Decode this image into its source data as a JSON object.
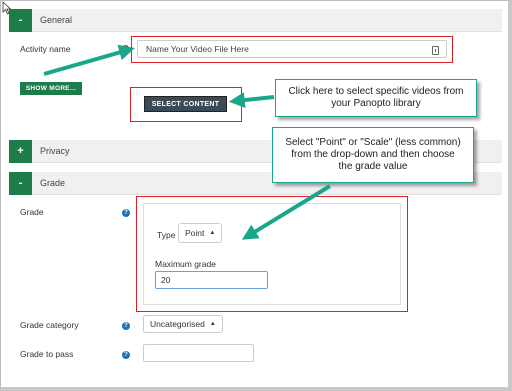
{
  "sections": {
    "general": {
      "toggle": "-",
      "title": "General"
    },
    "privacy": {
      "toggle": "+",
      "title": "Privacy"
    },
    "grade": {
      "toggle": "-",
      "title": "Grade"
    }
  },
  "activity_name": {
    "label": "Activity name",
    "value": "Name Your Video File Here"
  },
  "show_more_label": "SHOW MORE...",
  "select_content_label": "SELECT CONTENT",
  "callouts": {
    "select_content": "Click here to select specific videos from your Panopto library",
    "grade_type": "Select \"Point\" or \"Scale\" (less common) from the drop-down and then choose the grade value"
  },
  "grade": {
    "label": "Grade",
    "type_label": "Type",
    "type_value": "Point",
    "max_label": "Maximum grade",
    "max_value": "20"
  },
  "grade_category": {
    "label": "Grade category",
    "value": "Uncategorised"
  },
  "grade_to_pass": {
    "label": "Grade to pass",
    "value": ""
  },
  "colors": {
    "accent_green": "#1e7b4a",
    "highlight_red": "#d9232a",
    "callout_teal": "#1aa68a"
  }
}
